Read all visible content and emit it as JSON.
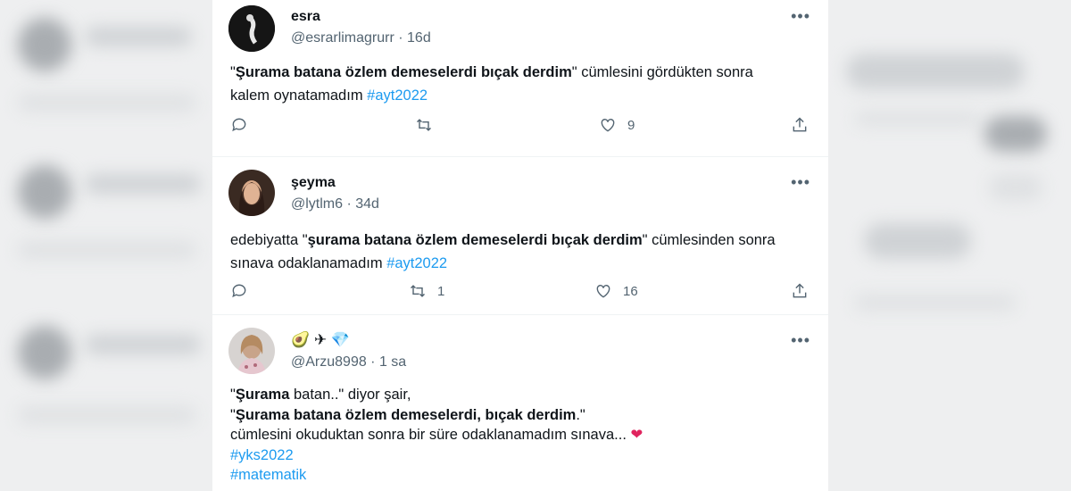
{
  "tweets": [
    {
      "name": "esra",
      "handle": "@esrarlimagrurr · 16d",
      "line1_pre": "\"",
      "line1_bold": "Şurama batana özlem demeselerdi bıçak derdim",
      "line1_post": "\" cümlesini gördükten sonra",
      "line2_pre": "kalem oynatamadım ",
      "hashtag": "#ayt2022",
      "retweets": "",
      "likes": "9"
    },
    {
      "name": "şeyma",
      "handle": "@lytlm6 · 34d",
      "line1_pre": "edebiyatta \"",
      "line1_bold": "şurama batana özlem demeselerdi bıçak derdim",
      "line1_post": "\" cümlesinden sonra",
      "line2_pre": "sınava odaklanamadım ",
      "hashtag": "#ayt2022",
      "retweets": "1",
      "likes": "16"
    },
    {
      "name": "🥑 ✈ 💎",
      "handle": "@Arzu8998 · 1 sa",
      "line1_pre": "\"",
      "line1_bold": "Şurama",
      "line1_post": " batan..\" diyor şair,",
      "line2_pre": "\"",
      "line2_bold": "Şurama batana özlem demeselerdi, bıçak derdim",
      "line2_post": ".\"",
      "line3": "cümlesini okuduktan sonra bir süre odaklanamadım sınava... ",
      "heart": "❤",
      "hashtag1": "#yks2022",
      "hashtag2": "#matematik"
    }
  ],
  "colors": {
    "accent": "#1d9bf0",
    "muted": "#536471",
    "text": "#0f1419",
    "heart": "#e0245e"
  }
}
